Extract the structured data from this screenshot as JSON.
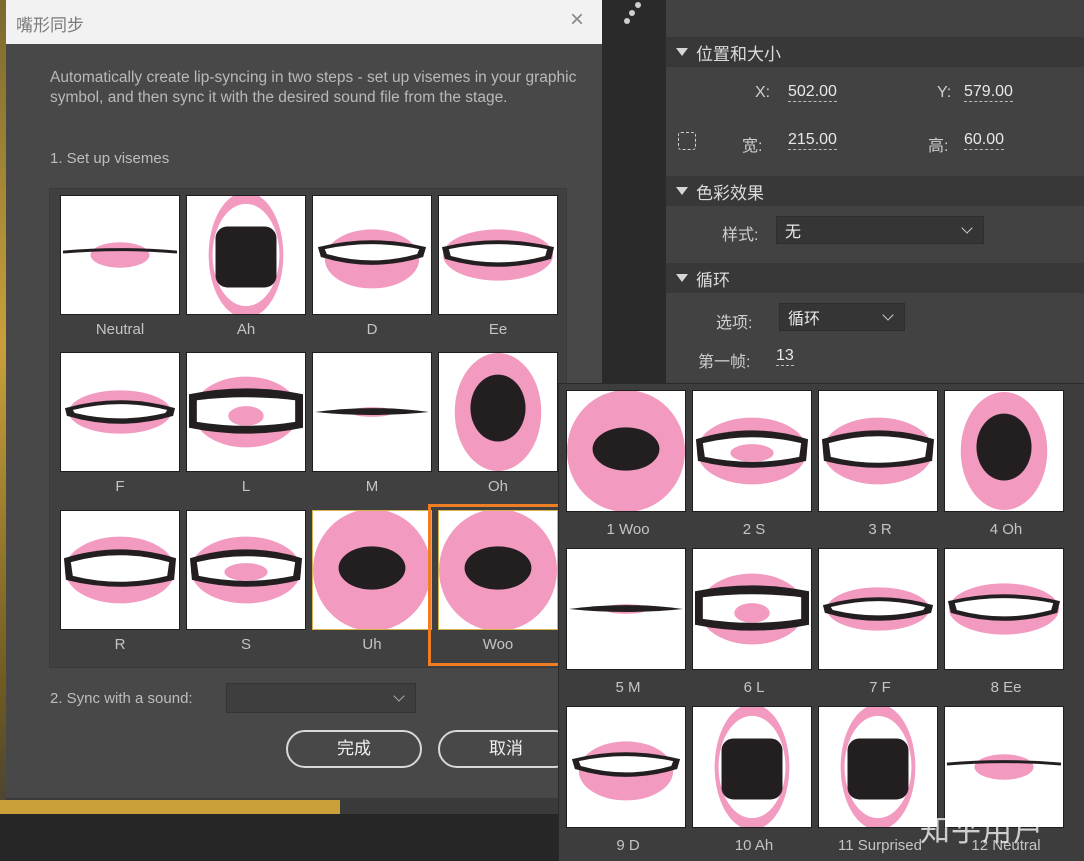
{
  "colors": {
    "accent_selected": "#ef7d24",
    "lip_pink": "#f29ac0",
    "dark": "#231f20"
  },
  "properties_panel": {
    "sections": [
      {
        "title": "位置和大小"
      },
      {
        "title": "色彩效果"
      },
      {
        "title": "循环"
      }
    ],
    "position": {
      "x_label": "X:",
      "x_value": "502.00",
      "y_label": "Y:",
      "y_value": "579.00"
    },
    "size": {
      "w_label": "宽:",
      "w_value": "215.00",
      "h_label": "高:",
      "h_value": "60.00",
      "link_icon": "link-icon"
    },
    "color_effect": {
      "style_label": "样式:",
      "style_value": "无"
    },
    "loop": {
      "option_label": "选项:",
      "option_value": "循环",
      "first_frame_label": "第一帧:",
      "first_frame_value": "13"
    }
  },
  "dialog": {
    "title": "嘴形同步",
    "close": "×",
    "description": "Automatically create lip-syncing in two steps - set up visemes in your graphic symbol, and then sync it with the desired sound file from the stage.",
    "step1": "1. Set up visemes",
    "visemes": [
      {
        "label": "Neutral",
        "shape": "neutral"
      },
      {
        "label": "Ah",
        "shape": "ah"
      },
      {
        "label": "D",
        "shape": "teeth"
      },
      {
        "label": "Ee",
        "shape": "teethwide"
      },
      {
        "label": "F",
        "shape": "f"
      },
      {
        "label": "L",
        "shape": "l"
      },
      {
        "label": "M",
        "shape": "m"
      },
      {
        "label": "Oh",
        "shape": "oh"
      },
      {
        "label": "R",
        "shape": "r"
      },
      {
        "label": "S",
        "shape": "s"
      },
      {
        "label": "Uh",
        "shape": "woo"
      },
      {
        "label": "Woo",
        "shape": "woo"
      }
    ],
    "selected_viseme": "Woo",
    "step2": "2. Sync with a sound:",
    "sound_value": "",
    "done_button": "完成",
    "cancel_button": "取消"
  },
  "popup": {
    "frames": [
      {
        "label": "1 Woo",
        "shape": "woo"
      },
      {
        "label": "2 S",
        "shape": "s"
      },
      {
        "label": "3 R",
        "shape": "r"
      },
      {
        "label": "4 Oh",
        "shape": "oh"
      },
      {
        "label": "5 M",
        "shape": "m"
      },
      {
        "label": "6 L",
        "shape": "l"
      },
      {
        "label": "7 F",
        "shape": "f"
      },
      {
        "label": "8 Ee",
        "shape": "teethwide"
      },
      {
        "label": "9 D",
        "shape": "teeth"
      },
      {
        "label": "10 Ah",
        "shape": "ah"
      },
      {
        "label": "11 Surprised",
        "shape": "ah"
      },
      {
        "label": "12 Neutral",
        "shape": "neutral"
      }
    ]
  },
  "watermark": "知乎用户"
}
